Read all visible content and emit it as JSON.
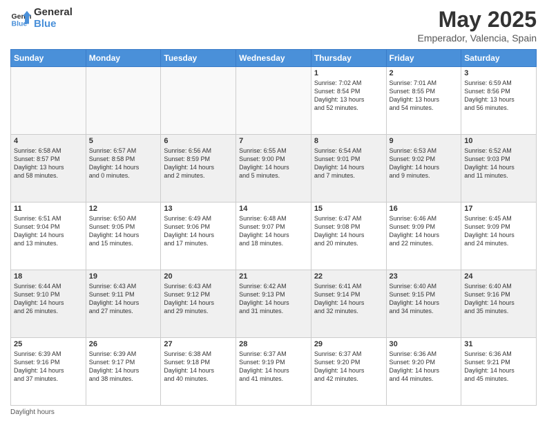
{
  "logo": {
    "line1": "General",
    "line2": "Blue"
  },
  "title": "May 2025",
  "subtitle": "Emperador, Valencia, Spain",
  "days_of_week": [
    "Sunday",
    "Monday",
    "Tuesday",
    "Wednesday",
    "Thursday",
    "Friday",
    "Saturday"
  ],
  "footer": "Daylight hours",
  "weeks": [
    [
      {
        "day": "",
        "content": ""
      },
      {
        "day": "",
        "content": ""
      },
      {
        "day": "",
        "content": ""
      },
      {
        "day": "",
        "content": ""
      },
      {
        "day": "1",
        "content": "Sunrise: 7:02 AM\nSunset: 8:54 PM\nDaylight: 13 hours\nand 52 minutes."
      },
      {
        "day": "2",
        "content": "Sunrise: 7:01 AM\nSunset: 8:55 PM\nDaylight: 13 hours\nand 54 minutes."
      },
      {
        "day": "3",
        "content": "Sunrise: 6:59 AM\nSunset: 8:56 PM\nDaylight: 13 hours\nand 56 minutes."
      }
    ],
    [
      {
        "day": "4",
        "content": "Sunrise: 6:58 AM\nSunset: 8:57 PM\nDaylight: 13 hours\nand 58 minutes."
      },
      {
        "day": "5",
        "content": "Sunrise: 6:57 AM\nSunset: 8:58 PM\nDaylight: 14 hours\nand 0 minutes."
      },
      {
        "day": "6",
        "content": "Sunrise: 6:56 AM\nSunset: 8:59 PM\nDaylight: 14 hours\nand 2 minutes."
      },
      {
        "day": "7",
        "content": "Sunrise: 6:55 AM\nSunset: 9:00 PM\nDaylight: 14 hours\nand 5 minutes."
      },
      {
        "day": "8",
        "content": "Sunrise: 6:54 AM\nSunset: 9:01 PM\nDaylight: 14 hours\nand 7 minutes."
      },
      {
        "day": "9",
        "content": "Sunrise: 6:53 AM\nSunset: 9:02 PM\nDaylight: 14 hours\nand 9 minutes."
      },
      {
        "day": "10",
        "content": "Sunrise: 6:52 AM\nSunset: 9:03 PM\nDaylight: 14 hours\nand 11 minutes."
      }
    ],
    [
      {
        "day": "11",
        "content": "Sunrise: 6:51 AM\nSunset: 9:04 PM\nDaylight: 14 hours\nand 13 minutes."
      },
      {
        "day": "12",
        "content": "Sunrise: 6:50 AM\nSunset: 9:05 PM\nDaylight: 14 hours\nand 15 minutes."
      },
      {
        "day": "13",
        "content": "Sunrise: 6:49 AM\nSunset: 9:06 PM\nDaylight: 14 hours\nand 17 minutes."
      },
      {
        "day": "14",
        "content": "Sunrise: 6:48 AM\nSunset: 9:07 PM\nDaylight: 14 hours\nand 18 minutes."
      },
      {
        "day": "15",
        "content": "Sunrise: 6:47 AM\nSunset: 9:08 PM\nDaylight: 14 hours\nand 20 minutes."
      },
      {
        "day": "16",
        "content": "Sunrise: 6:46 AM\nSunset: 9:09 PM\nDaylight: 14 hours\nand 22 minutes."
      },
      {
        "day": "17",
        "content": "Sunrise: 6:45 AM\nSunset: 9:09 PM\nDaylight: 14 hours\nand 24 minutes."
      }
    ],
    [
      {
        "day": "18",
        "content": "Sunrise: 6:44 AM\nSunset: 9:10 PM\nDaylight: 14 hours\nand 26 minutes."
      },
      {
        "day": "19",
        "content": "Sunrise: 6:43 AM\nSunset: 9:11 PM\nDaylight: 14 hours\nand 27 minutes."
      },
      {
        "day": "20",
        "content": "Sunrise: 6:43 AM\nSunset: 9:12 PM\nDaylight: 14 hours\nand 29 minutes."
      },
      {
        "day": "21",
        "content": "Sunrise: 6:42 AM\nSunset: 9:13 PM\nDaylight: 14 hours\nand 31 minutes."
      },
      {
        "day": "22",
        "content": "Sunrise: 6:41 AM\nSunset: 9:14 PM\nDaylight: 14 hours\nand 32 minutes."
      },
      {
        "day": "23",
        "content": "Sunrise: 6:40 AM\nSunset: 9:15 PM\nDaylight: 14 hours\nand 34 minutes."
      },
      {
        "day": "24",
        "content": "Sunrise: 6:40 AM\nSunset: 9:16 PM\nDaylight: 14 hours\nand 35 minutes."
      }
    ],
    [
      {
        "day": "25",
        "content": "Sunrise: 6:39 AM\nSunset: 9:16 PM\nDaylight: 14 hours\nand 37 minutes."
      },
      {
        "day": "26",
        "content": "Sunrise: 6:39 AM\nSunset: 9:17 PM\nDaylight: 14 hours\nand 38 minutes."
      },
      {
        "day": "27",
        "content": "Sunrise: 6:38 AM\nSunset: 9:18 PM\nDaylight: 14 hours\nand 40 minutes."
      },
      {
        "day": "28",
        "content": "Sunrise: 6:37 AM\nSunset: 9:19 PM\nDaylight: 14 hours\nand 41 minutes."
      },
      {
        "day": "29",
        "content": "Sunrise: 6:37 AM\nSunset: 9:20 PM\nDaylight: 14 hours\nand 42 minutes."
      },
      {
        "day": "30",
        "content": "Sunrise: 6:36 AM\nSunset: 9:20 PM\nDaylight: 14 hours\nand 44 minutes."
      },
      {
        "day": "31",
        "content": "Sunrise: 6:36 AM\nSunset: 9:21 PM\nDaylight: 14 hours\nand 45 minutes."
      }
    ]
  ]
}
